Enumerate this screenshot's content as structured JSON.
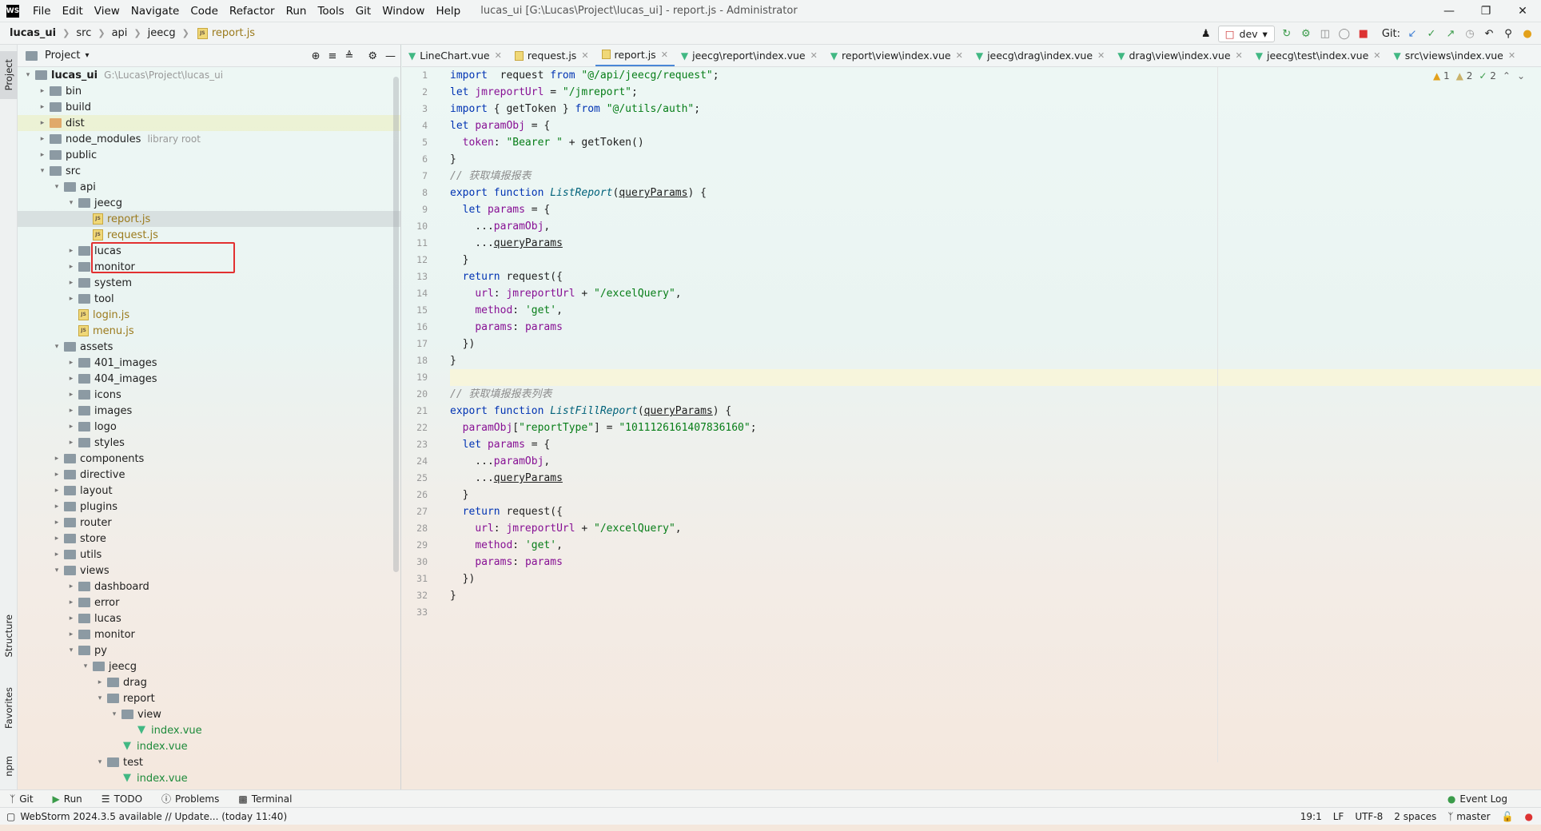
{
  "titlebar": {
    "logo": "WS",
    "menu": [
      "File",
      "Edit",
      "View",
      "Navigate",
      "Code",
      "Refactor",
      "Run",
      "Tools",
      "Git",
      "Window",
      "Help"
    ],
    "title": "lucas_ui [G:\\Lucas\\Project\\lucas_ui] - report.js - Administrator"
  },
  "breadcrumb": [
    "lucas_ui",
    "src",
    "api",
    "jeecg",
    "report.js"
  ],
  "toolbar": {
    "run_config": "dev",
    "git_label": "Git:"
  },
  "project_panel": {
    "title": "Project",
    "tree": [
      {
        "name": "lucas_ui",
        "path": "G:\\Lucas\\Project\\lucas_ui",
        "depth": 0,
        "type": "folder",
        "open": true
      },
      {
        "name": "bin",
        "depth": 1,
        "type": "folder"
      },
      {
        "name": "build",
        "depth": 1,
        "type": "folder"
      },
      {
        "name": "dist",
        "depth": 1,
        "type": "folder-orange"
      },
      {
        "name": "node_modules",
        "extra": "library root",
        "depth": 1,
        "type": "folder"
      },
      {
        "name": "public",
        "depth": 1,
        "type": "folder"
      },
      {
        "name": "src",
        "depth": 1,
        "type": "folder",
        "open": true
      },
      {
        "name": "api",
        "depth": 2,
        "type": "folder",
        "open": true
      },
      {
        "name": "jeecg",
        "depth": 3,
        "type": "folder",
        "open": true
      },
      {
        "name": "report.js",
        "depth": 4,
        "type": "js",
        "selected": true
      },
      {
        "name": "request.js",
        "depth": 4,
        "type": "js"
      },
      {
        "name": "lucas",
        "depth": 3,
        "type": "folder"
      },
      {
        "name": "monitor",
        "depth": 3,
        "type": "folder"
      },
      {
        "name": "system",
        "depth": 3,
        "type": "folder"
      },
      {
        "name": "tool",
        "depth": 3,
        "type": "folder"
      },
      {
        "name": "login.js",
        "depth": 3,
        "type": "js"
      },
      {
        "name": "menu.js",
        "depth": 3,
        "type": "js"
      },
      {
        "name": "assets",
        "depth": 2,
        "type": "folder",
        "open": true
      },
      {
        "name": "401_images",
        "depth": 3,
        "type": "folder"
      },
      {
        "name": "404_images",
        "depth": 3,
        "type": "folder"
      },
      {
        "name": "icons",
        "depth": 3,
        "type": "folder"
      },
      {
        "name": "images",
        "depth": 3,
        "type": "folder"
      },
      {
        "name": "logo",
        "depth": 3,
        "type": "folder"
      },
      {
        "name": "styles",
        "depth": 3,
        "type": "folder"
      },
      {
        "name": "components",
        "depth": 2,
        "type": "folder"
      },
      {
        "name": "directive",
        "depth": 2,
        "type": "folder"
      },
      {
        "name": "layout",
        "depth": 2,
        "type": "folder"
      },
      {
        "name": "plugins",
        "depth": 2,
        "type": "folder"
      },
      {
        "name": "router",
        "depth": 2,
        "type": "folder"
      },
      {
        "name": "store",
        "depth": 2,
        "type": "folder"
      },
      {
        "name": "utils",
        "depth": 2,
        "type": "folder"
      },
      {
        "name": "views",
        "depth": 2,
        "type": "folder",
        "open": true
      },
      {
        "name": "dashboard",
        "depth": 3,
        "type": "folder"
      },
      {
        "name": "error",
        "depth": 3,
        "type": "folder"
      },
      {
        "name": "lucas",
        "depth": 3,
        "type": "folder"
      },
      {
        "name": "monitor",
        "depth": 3,
        "type": "folder"
      },
      {
        "name": "py",
        "depth": 3,
        "type": "folder",
        "open": true
      },
      {
        "name": "jeecg",
        "depth": 4,
        "type": "folder",
        "open": true
      },
      {
        "name": "drag",
        "depth": 5,
        "type": "folder"
      },
      {
        "name": "report",
        "depth": 5,
        "type": "folder",
        "open": true
      },
      {
        "name": "view",
        "depth": 6,
        "type": "folder",
        "open": true
      },
      {
        "name": "index.vue",
        "depth": 7,
        "type": "vue"
      },
      {
        "name": "index.vue",
        "depth": 6,
        "type": "vue"
      },
      {
        "name": "test",
        "depth": 5,
        "type": "folder",
        "open": true
      },
      {
        "name": "index.vue",
        "depth": 6,
        "type": "vue"
      }
    ]
  },
  "left_strip": {
    "project": "Project",
    "structure": "Structure",
    "favorites": "Favorites",
    "npm": "npm"
  },
  "editor": {
    "tabs": [
      {
        "label": "LineChart.vue",
        "icon": "vue"
      },
      {
        "label": "request.js",
        "icon": "js"
      },
      {
        "label": "report.js",
        "icon": "js",
        "active": true
      },
      {
        "label": "jeecg\\report\\index.vue",
        "icon": "vue"
      },
      {
        "label": "report\\view\\index.vue",
        "icon": "vue"
      },
      {
        "label": "jeecg\\drag\\index.vue",
        "icon": "vue"
      },
      {
        "label": "drag\\view\\index.vue",
        "icon": "vue"
      },
      {
        "label": "jeecg\\test\\index.vue",
        "icon": "vue"
      },
      {
        "label": "src\\views\\index.vue",
        "icon": "vue"
      }
    ],
    "inspections": {
      "warn_strong": "1",
      "warn_weak": "2",
      "ok": "2"
    },
    "line_numbers": [
      "1",
      "2",
      "3",
      "4",
      "5",
      "6",
      "7",
      "8",
      "9",
      "10",
      "11",
      "12",
      "13",
      "14",
      "15",
      "16",
      "17",
      "18",
      "19",
      "20",
      "21",
      "22",
      "23",
      "24",
      "25",
      "26",
      "27",
      "28",
      "29",
      "30",
      "31",
      "32",
      "33"
    ],
    "lines": [
      [
        [
          "kw",
          "import"
        ],
        [
          "",
          "  request "
        ],
        [
          "kw",
          "from"
        ],
        [
          "",
          " "
        ],
        [
          "str",
          "\"@/api/jeecg/request\""
        ],
        [
          "",
          ";"
        ]
      ],
      [
        [
          "kw",
          "let"
        ],
        [
          "",
          " "
        ],
        [
          "pv",
          "jmreportUrl"
        ],
        [
          "",
          " = "
        ],
        [
          "str",
          "\"/jmreport\""
        ],
        [
          "",
          ";"
        ]
      ],
      [
        [
          "kw",
          "import"
        ],
        [
          "",
          " { getToken } "
        ],
        [
          "kw",
          "from"
        ],
        [
          "",
          " "
        ],
        [
          "str",
          "\"@/utils/auth\""
        ],
        [
          "",
          ";"
        ]
      ],
      [
        [
          "kw",
          "let"
        ],
        [
          "",
          " "
        ],
        [
          "pv",
          "paramObj"
        ],
        [
          "",
          " = {"
        ]
      ],
      [
        [
          "",
          "  "
        ],
        [
          "pv",
          "token"
        ],
        [
          "",
          ": "
        ],
        [
          "str",
          "\"Bearer \""
        ],
        [
          "",
          " + getToken()"
        ]
      ],
      [
        [
          "",
          "}"
        ]
      ],
      [
        [
          "cm",
          "// 获取填报报表"
        ]
      ],
      [
        [
          "kw",
          "export function"
        ],
        [
          "",
          " "
        ],
        [
          "fn",
          "ListReport"
        ],
        [
          "",
          "("
        ],
        [
          "ul",
          "queryParams"
        ],
        [
          "",
          ") {"
        ]
      ],
      [
        [
          "",
          "  "
        ],
        [
          "kw",
          "let"
        ],
        [
          "",
          " "
        ],
        [
          "pv",
          "params"
        ],
        [
          "",
          " = {"
        ]
      ],
      [
        [
          "",
          "    ..."
        ],
        [
          "pv",
          "paramObj"
        ],
        [
          "",
          ","
        ]
      ],
      [
        [
          "",
          "    ..."
        ],
        [
          "ul",
          "queryParams"
        ]
      ],
      [
        [
          "",
          "  }"
        ]
      ],
      [
        [
          "",
          "  "
        ],
        [
          "kw",
          "return"
        ],
        [
          "",
          " request({"
        ]
      ],
      [
        [
          "",
          "    "
        ],
        [
          "pv",
          "url"
        ],
        [
          "",
          ": "
        ],
        [
          "pv",
          "jmreportUrl"
        ],
        [
          "",
          " + "
        ],
        [
          "str",
          "\"/excelQuery\""
        ],
        [
          "",
          ","
        ]
      ],
      [
        [
          "",
          "    "
        ],
        [
          "pv",
          "method"
        ],
        [
          "",
          ": "
        ],
        [
          "str",
          "'get'"
        ],
        [
          "",
          ","
        ]
      ],
      [
        [
          "",
          "    "
        ],
        [
          "pv",
          "params"
        ],
        [
          "",
          ": "
        ],
        [
          "pv",
          "params"
        ]
      ],
      [
        [
          "",
          "  })"
        ]
      ],
      [
        [
          "",
          "}"
        ]
      ],
      [
        [
          "",
          ""
        ]
      ],
      [
        [
          "cm",
          "// 获取填报报表列表"
        ]
      ],
      [
        [
          "kw",
          "export function"
        ],
        [
          "",
          " "
        ],
        [
          "fn",
          "ListFillReport"
        ],
        [
          "",
          "("
        ],
        [
          "ul",
          "queryParams"
        ],
        [
          "",
          ") {"
        ]
      ],
      [
        [
          "",
          "  "
        ],
        [
          "pv",
          "paramObj"
        ],
        [
          "",
          "["
        ],
        [
          "str",
          "\"reportType\""
        ],
        [
          "",
          "] = "
        ],
        [
          "str",
          "\"1011126161407836160\""
        ],
        [
          "",
          ";"
        ]
      ],
      [
        [
          "",
          "  "
        ],
        [
          "kw",
          "let"
        ],
        [
          "",
          " "
        ],
        [
          "pv",
          "params"
        ],
        [
          "",
          " = {"
        ]
      ],
      [
        [
          "",
          "    ..."
        ],
        [
          "pv",
          "paramObj"
        ],
        [
          "",
          ","
        ]
      ],
      [
        [
          "",
          "    ..."
        ],
        [
          "ul",
          "queryParams"
        ]
      ],
      [
        [
          "",
          "  }"
        ]
      ],
      [
        [
          "",
          "  "
        ],
        [
          "kw",
          "return"
        ],
        [
          "",
          " request({"
        ]
      ],
      [
        [
          "",
          "    "
        ],
        [
          "pv",
          "url"
        ],
        [
          "",
          ": "
        ],
        [
          "pv",
          "jmreportUrl"
        ],
        [
          "",
          " + "
        ],
        [
          "str",
          "\"/excelQuery\""
        ],
        [
          "",
          ","
        ]
      ],
      [
        [
          "",
          "    "
        ],
        [
          "pv",
          "method"
        ],
        [
          "",
          ": "
        ],
        [
          "str",
          "'get'"
        ],
        [
          "",
          ","
        ]
      ],
      [
        [
          "",
          "    "
        ],
        [
          "pv",
          "params"
        ],
        [
          "",
          ": "
        ],
        [
          "pv",
          "params"
        ]
      ],
      [
        [
          "",
          "  })"
        ]
      ],
      [
        [
          "",
          "}"
        ]
      ],
      [
        [
          "",
          ""
        ]
      ]
    ]
  },
  "bottom_tabs": [
    "Git",
    "Run",
    "TODO",
    "Problems",
    "Terminal",
    "Event Log"
  ],
  "status_bar": {
    "message": "WebStorm 2024.3.5 available // Update... (today 11:40)",
    "position": "19:1",
    "line_sep": "LF",
    "encoding": "UTF-8",
    "indent": "2 spaces",
    "branch": "master"
  }
}
